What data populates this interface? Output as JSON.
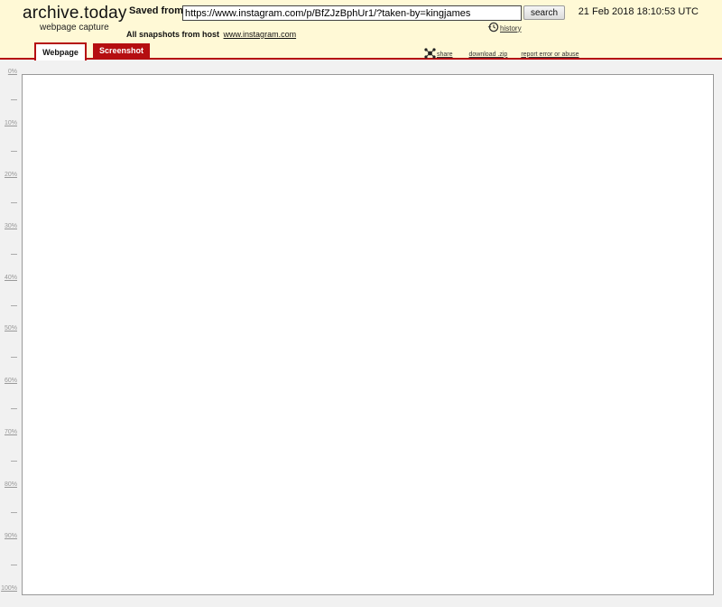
{
  "header": {
    "logo": "archive.today",
    "logo_sub": "webpage capture",
    "saved_from_label": "Saved from",
    "url_value": "https://www.instagram.com/p/BfZJzBphUr1/?taken-by=kingjames",
    "search_label": "search",
    "date": "21 Feb 2018 18:10:53 UTC",
    "history_label": "history",
    "all_snapshots_label": "All snapshots",
    "from_host_label": "from host",
    "host_link": "www.instagram.com"
  },
  "tabs": [
    {
      "label": "Webpage",
      "active": true
    },
    {
      "label": "Screenshot",
      "active": false
    }
  ],
  "links": {
    "share": "share",
    "download": "download .zip",
    "report": "report error or abuse"
  },
  "ruler": {
    "labels": [
      "0%",
      "10%",
      "20%",
      "30%",
      "40%",
      "50%",
      "60%",
      "70%",
      "80%",
      "90%",
      "100%"
    ]
  },
  "colors": {
    "header_bg": "#fff9d6",
    "accent": "#b50e11"
  }
}
